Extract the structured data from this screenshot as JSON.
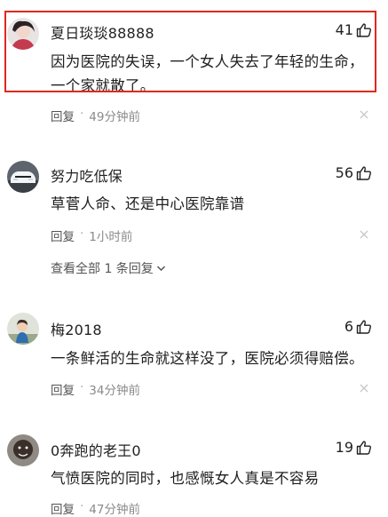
{
  "comments": [
    {
      "username": "夏日琰琰88888",
      "likes": "41",
      "text": "因为医院的失误，一个女人失去了年轻的生命，一个家就散了。",
      "reply_label": "回复",
      "separator": "·",
      "time": "49分钟前",
      "highlighted": true
    },
    {
      "username": "努力吃低保",
      "likes": "56",
      "text": "草菅人命、还是中心医院靠谱",
      "reply_label": "回复",
      "separator": "·",
      "time": "1小时前"
    },
    {
      "username": "梅2018",
      "likes": "6",
      "text": "一条鲜活的生命就这样没了，医院必须得赔偿。",
      "reply_label": "回复",
      "separator": "·",
      "time": "34分钟前"
    },
    {
      "username": "0奔跑的老王0",
      "likes": "19",
      "text": "气愤医院的同时，也感慨女人真是不容易",
      "reply_label": "回复",
      "separator": "·",
      "time": "47分钟前"
    }
  ],
  "view_all_replies": "查看全部 1 条回复",
  "colors": {
    "highlight_border": "#e0281e",
    "meta_text": "#8a8a8a"
  }
}
